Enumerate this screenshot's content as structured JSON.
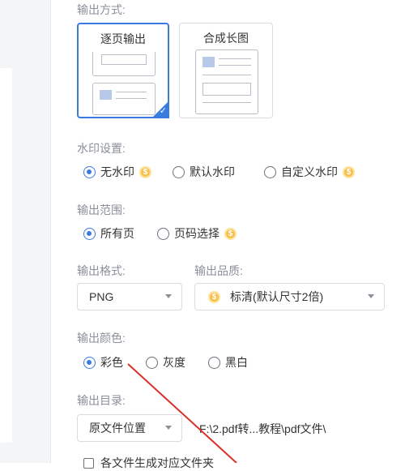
{
  "output_mode": {
    "label": "输出方式:",
    "options": [
      {
        "label": "逐页输出",
        "selected": true
      },
      {
        "label": "合成长图",
        "selected": false
      }
    ]
  },
  "watermark": {
    "label": "水印设置:",
    "options": [
      {
        "label": "无水印",
        "checked": true,
        "vip": true
      },
      {
        "label": "默认水印",
        "checked": false,
        "vip": false
      },
      {
        "label": "自定义水印",
        "checked": false,
        "vip": true
      }
    ]
  },
  "range": {
    "label": "输出范围:",
    "options": [
      {
        "label": "所有页",
        "checked": true,
        "vip": false
      },
      {
        "label": "页码选择",
        "checked": false,
        "vip": true
      }
    ]
  },
  "format": {
    "label": "输出格式:",
    "value": "PNG"
  },
  "quality": {
    "label": "输出品质:",
    "value": "标清(默认尺寸2倍)"
  },
  "color": {
    "label": "输出颜色:",
    "options": [
      {
        "label": "彩色",
        "checked": true
      },
      {
        "label": "灰度",
        "checked": false
      },
      {
        "label": "黑白",
        "checked": false
      }
    ]
  },
  "directory": {
    "label": "输出目录:",
    "value": "原文件位置",
    "path": "F:\\2.pdf转...教程\\pdf文件\\"
  },
  "per_file_folder": {
    "label": "各文件生成对应文件夹"
  },
  "vip_symbol": "$",
  "check_symbol": "✓",
  "colors": {
    "accent": "#3a7be0",
    "vip": "#f6c04a",
    "annotation": "#d9302a"
  }
}
